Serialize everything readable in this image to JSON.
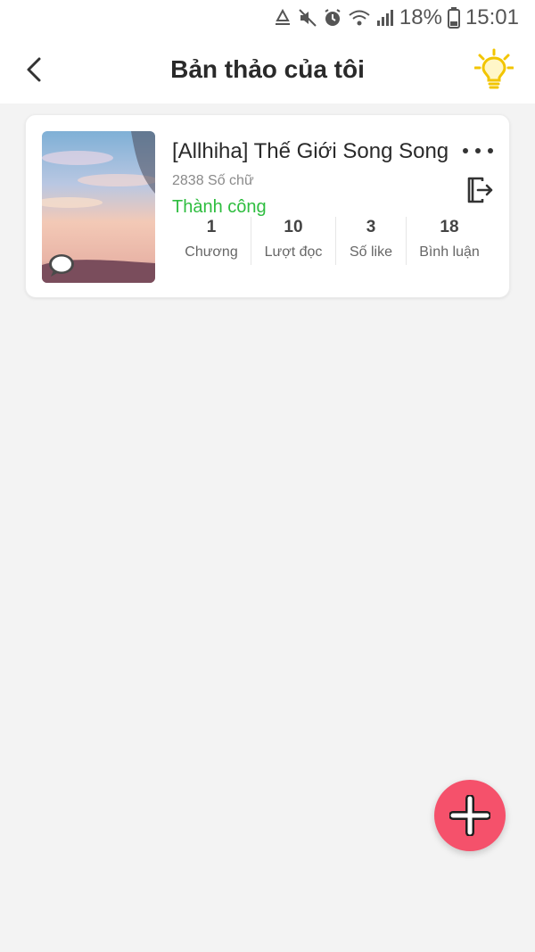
{
  "status_bar": {
    "battery": "18%",
    "time": "15:01",
    "icons": [
      "recycle-icon",
      "mute-icon",
      "alarm-icon",
      "wifi-icon",
      "signal-icon",
      "battery-icon"
    ]
  },
  "header": {
    "title": "Bản thảo của tôi",
    "back_icon": "back-arrow-icon",
    "idea_icon": "lightbulb-icon"
  },
  "colors": {
    "accent_yellow": "#f2c500",
    "success_green": "#2ebd3f",
    "fab_red": "#f5516b",
    "background": "#f3f3f3"
  },
  "draft": {
    "title": "[Allhiha] Thế Giới Song Song",
    "word_count": "2838 Số chữ",
    "status": "Thành công",
    "stats": [
      {
        "value": "1",
        "label": "Chương"
      },
      {
        "value": "10",
        "label": "Lượt đọc"
      },
      {
        "value": "3",
        "label": "Số like"
      },
      {
        "value": "18",
        "label": "Bình luận"
      }
    ],
    "more_icon": "more-dots-icon",
    "export_icon": "export-icon"
  },
  "fab": {
    "icon": "plus-icon"
  }
}
